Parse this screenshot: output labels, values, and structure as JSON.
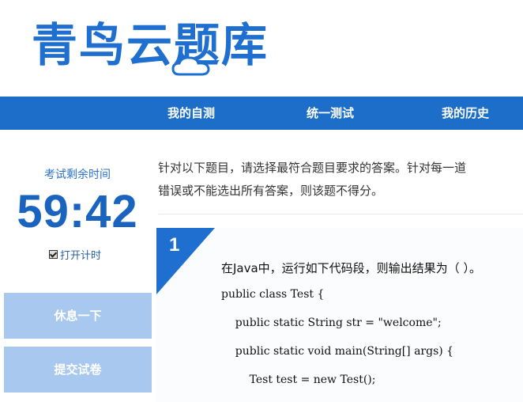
{
  "header": {
    "logo_text": "青鸟云题库"
  },
  "nav": {
    "items": [
      {
        "label": "我的自测"
      },
      {
        "label": "统一测试"
      },
      {
        "label": "我的历史"
      }
    ]
  },
  "sidebar": {
    "timer_label": "考试剩余时间",
    "timer_value": "59:42",
    "timer_toggle_label": "打开计时",
    "rest_button": "休息一下",
    "submit_button": "提交试卷"
  },
  "instructions": {
    "line1": "针对以下题目，请选择最符合题目要求的答案。针对每一道",
    "line2": "错误或不能选出所有答案，则该题不得分。"
  },
  "question": {
    "number": "1",
    "text": "在Java中，运行如下代码段，则输出结果为（ ）。",
    "code": [
      "public class Test {",
      "    public static String str = \"welcome\";",
      "    public static void main(String[] args) {",
      "        Test test = new Test();"
    ]
  },
  "colors": {
    "brand_blue": "#1f6fd1",
    "nav_bar": "#1c6ec8",
    "side_button": "#a9c8ef"
  }
}
